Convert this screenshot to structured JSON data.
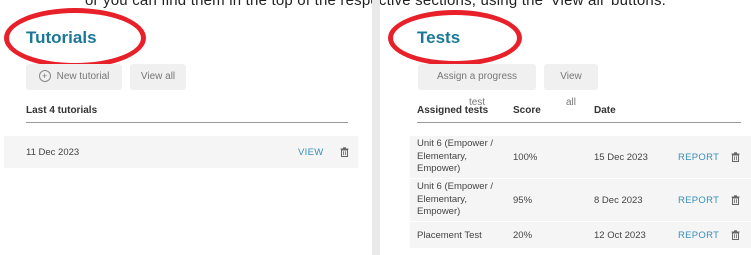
{
  "instruction": "or you can find them in the top of the respective sections, using the 'View all' buttons.",
  "tutorials": {
    "title": "Tutorials",
    "new_button": "New tutorial",
    "view_all": "View all",
    "section_label": "Last 4 tutorials",
    "rows": [
      {
        "date": "11 Dec 2023",
        "action": "VIEW"
      }
    ]
  },
  "tests": {
    "title": "Tests",
    "assign_button": "Assign a progress test",
    "view_all": "View all",
    "columns": {
      "assigned": "Assigned tests",
      "score": "Score",
      "date": "Date"
    },
    "rows": [
      {
        "name": "Unit 6 (Empower / Elementary, Empower)",
        "score": "100%",
        "date": "15 Dec 2023",
        "action": "REPORT"
      },
      {
        "name": "Unit 6 (Empower / Elementary, Empower)",
        "score": "95%",
        "date": "8 Dec 2023",
        "action": "REPORT"
      },
      {
        "name": "Placement Test",
        "score": "20%",
        "date": "12 Oct 2023",
        "action": "REPORT"
      }
    ]
  },
  "colors": {
    "title": "#1b7898",
    "link": "#3a8fb7",
    "highlight": "#e8202a"
  }
}
